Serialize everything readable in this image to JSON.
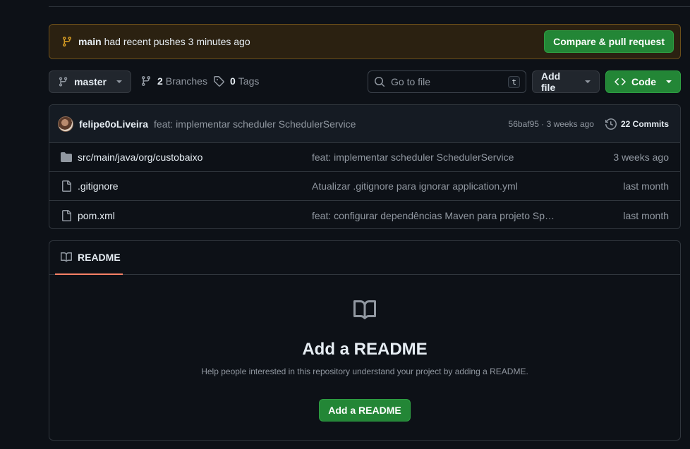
{
  "banner": {
    "branch": "main",
    "message": "had recent pushes 3 minutes ago",
    "button": "Compare & pull request"
  },
  "toolbar": {
    "branch_select": "master",
    "branches_count": "2",
    "branches_label": "Branches",
    "tags_count": "0",
    "tags_label": "Tags",
    "search_placeholder": "Go to file",
    "search_shortcut": "t",
    "add_file": "Add file",
    "code": "Code"
  },
  "latest_commit": {
    "author": "felipe0oLiveira",
    "message": "feat: implementar scheduler SchedulerService",
    "sha_time": "56baf95 · 3 weeks ago",
    "commits": "22 Commits"
  },
  "files": [
    {
      "type": "folder",
      "name": "src/main/java/org/custobaixo",
      "message": "feat: implementar scheduler SchedulerService",
      "date": "3 weeks ago"
    },
    {
      "type": "file",
      "name": ".gitignore",
      "message": "Atualizar .gitignore para ignorar application.yml",
      "date": "last month"
    },
    {
      "type": "file",
      "name": "pom.xml",
      "message": "feat: configurar dependências Maven para projeto Spring Bo…",
      "date": "last month"
    }
  ],
  "readme": {
    "tab": "README",
    "title": "Add a README",
    "subtitle": "Help people interested in this repository understand your project by adding a README.",
    "button": "Add a README"
  },
  "colors": {
    "accent_green": "#238636",
    "banner_bg": "#2b2111",
    "tab_underline": "#f78166"
  }
}
